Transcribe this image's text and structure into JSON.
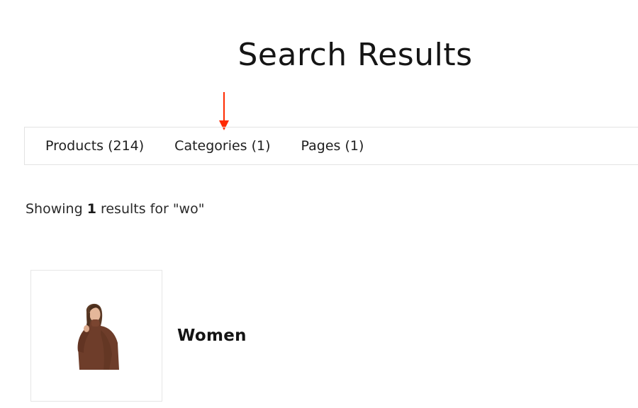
{
  "page": {
    "title": "Search Results"
  },
  "tabs": [
    {
      "label": "Products (214)"
    },
    {
      "label": "Categories (1)"
    },
    {
      "label": "Pages (1)"
    }
  ],
  "summary": {
    "prefix": "Showing ",
    "count": "1",
    "suffix": " results for \"wo\""
  },
  "results": [
    {
      "name": "Women",
      "image": "woman-in-brown-turtleneck-photo"
    }
  ],
  "colors": {
    "annotation_arrow": "#ff2a00",
    "tab_border": "#e3e3e3",
    "card_border": "#e6e6e6"
  }
}
